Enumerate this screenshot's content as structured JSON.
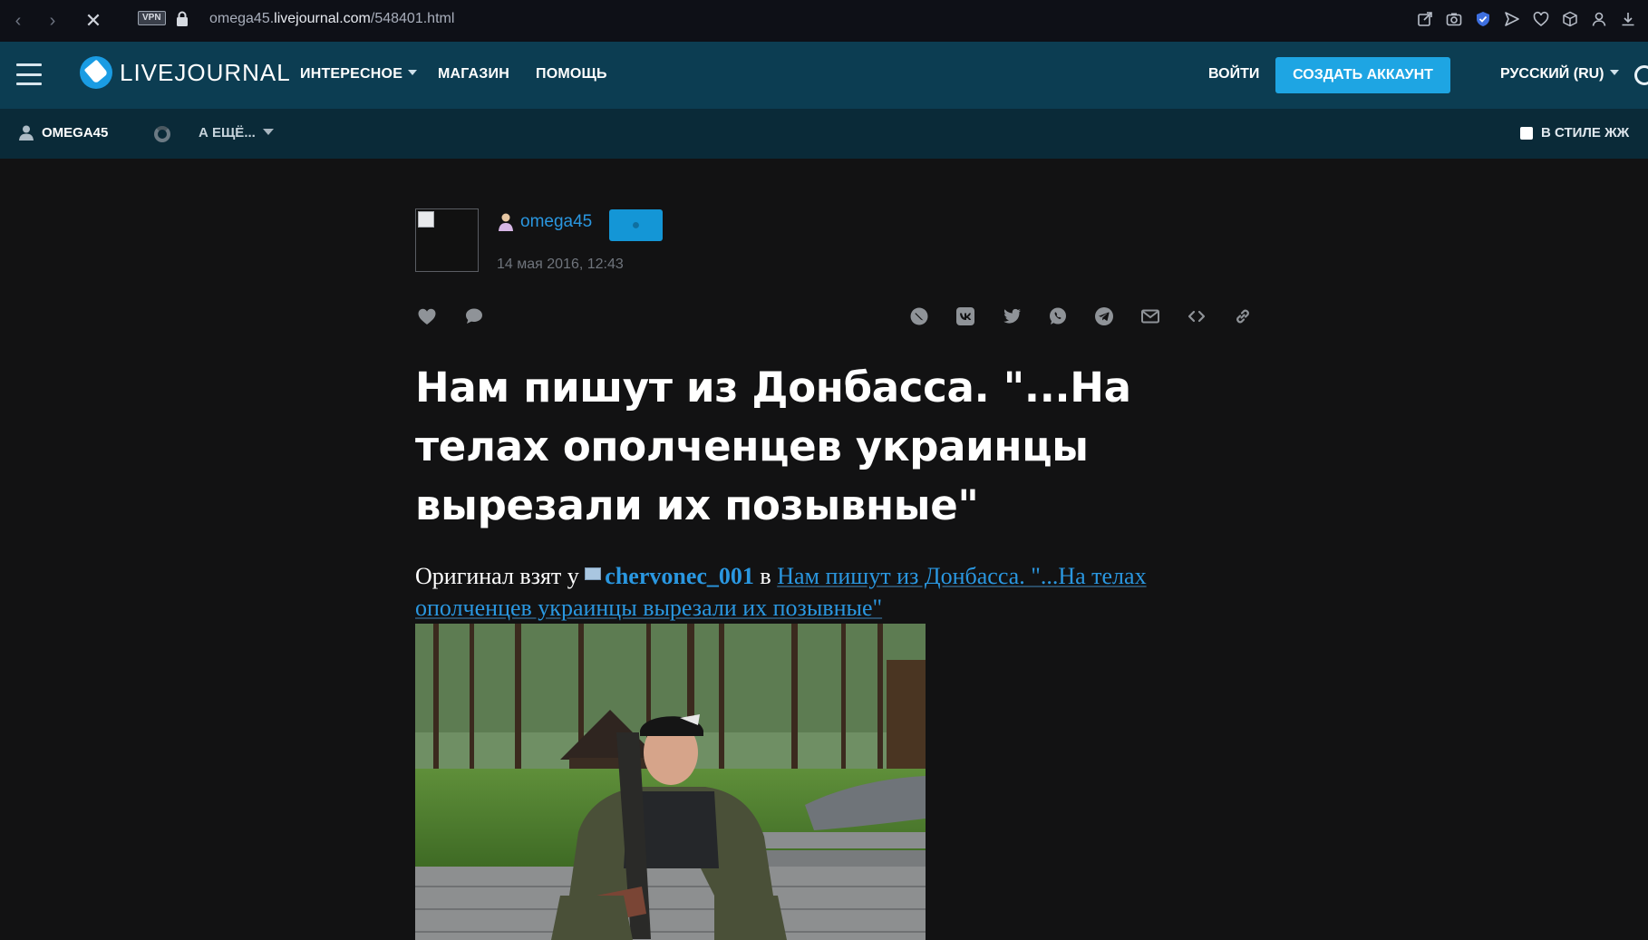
{
  "browser": {
    "vpn_label": "VPN",
    "url_subdomain": "omega45.",
    "url_host": "livejournal.com",
    "url_path": "/548401.html"
  },
  "header": {
    "logo_text": "LIVEJOURNAL",
    "nav": [
      {
        "label": "ИНТЕРЕСНОЕ",
        "has_dropdown": true
      },
      {
        "label": "МАГАЗИН",
        "has_dropdown": false
      },
      {
        "label": "ПОМОЩЬ",
        "has_dropdown": false
      }
    ],
    "login_label": "ВОЙТИ",
    "create_account_label": "СОЗДАТЬ АККАУНТ",
    "language_label": "РУССКИЙ (RU)"
  },
  "subbar": {
    "username": "OMEGA45",
    "more_label": "А ЕЩЁ...",
    "style_toggle_label": "В СТИЛЕ ЖЖ"
  },
  "post": {
    "author": "omega45",
    "date": "14 мая 2016, 12:43",
    "title": "Нам пишут из Донбасса. \"...На телах ополченцев украинцы вырезали их позывные\"",
    "body_prefix": "Оригинал взят у ",
    "source_user": "chervonec_001",
    "body_in": " в ",
    "source_link_text": "Нам пишут из Донбасса. \"...На телах ополченцев украинцы вырезали их позывные\""
  },
  "colors": {
    "header_bg": "#0c3d52",
    "subbar_bg": "#0a2a38",
    "accent": "#1ea5e3",
    "link": "#2a97e0",
    "page_bg": "#121213"
  },
  "icons": {
    "share": [
      "livejournal-repost-icon",
      "vk-icon",
      "twitter-icon",
      "whatsapp-icon",
      "telegram-icon",
      "email-icon",
      "embed-icon",
      "link-icon"
    ],
    "actions": [
      "like-heart-icon",
      "comment-icon"
    ]
  }
}
